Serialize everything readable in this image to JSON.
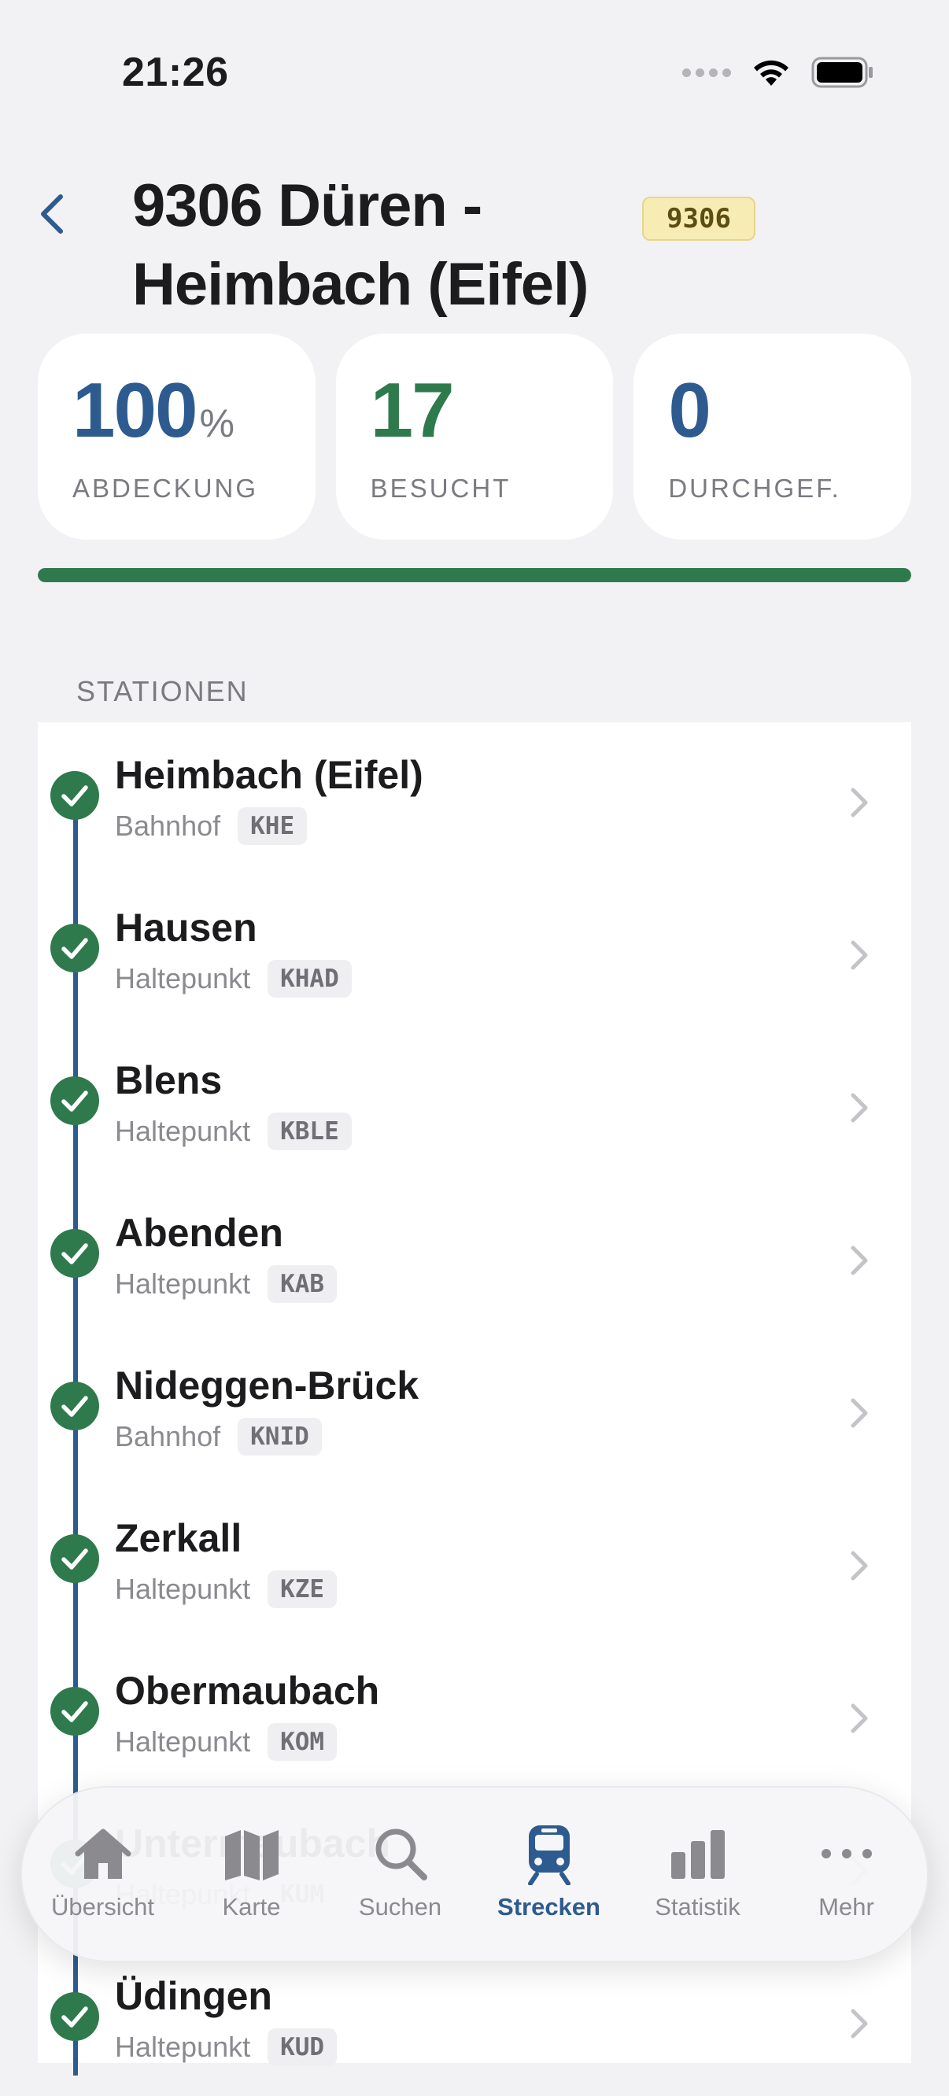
{
  "status_bar": {
    "time": "21:26"
  },
  "header": {
    "title": "9306 Düren - Heimbach (Eifel)",
    "badge": "9306"
  },
  "stats": [
    {
      "value": "100",
      "unit": "%",
      "label": "ABDECKUNG",
      "color": "#2e5b8f"
    },
    {
      "value": "17",
      "unit": "",
      "label": "BESUCHT",
      "color": "#2f7a4c"
    },
    {
      "value": "0",
      "unit": "",
      "label": "DURCHGEF.",
      "color": "#2e5b8f"
    }
  ],
  "coverage_progress": 1.0,
  "section_label": "STATIONEN",
  "stations": [
    {
      "name": "Heimbach (Eifel)",
      "type": "Bahnhof",
      "code": "KHE"
    },
    {
      "name": "Hausen",
      "type": "Haltepunkt",
      "code": "KHAD"
    },
    {
      "name": "Blens",
      "type": "Haltepunkt",
      "code": "KBLE"
    },
    {
      "name": "Abenden",
      "type": "Haltepunkt",
      "code": "KAB"
    },
    {
      "name": "Nideggen-Brück",
      "type": "Bahnhof",
      "code": "KNID"
    },
    {
      "name": "Zerkall",
      "type": "Haltepunkt",
      "code": "KZE"
    },
    {
      "name": "Obermaubach",
      "type": "Haltepunkt",
      "code": "KOM"
    },
    {
      "name": "Untermaubach",
      "type": "Haltepunkt",
      "code": "KUM"
    },
    {
      "name": "Üdingen",
      "type": "Haltepunkt",
      "code": "KUD"
    }
  ],
  "tabs": [
    {
      "label": "Übersicht",
      "icon": "house-icon",
      "active": false
    },
    {
      "label": "Karte",
      "icon": "map-icon",
      "active": false
    },
    {
      "label": "Suchen",
      "icon": "search-icon",
      "active": false
    },
    {
      "label": "Strecken",
      "icon": "train-icon",
      "active": true
    },
    {
      "label": "Statistik",
      "icon": "bar-chart-icon",
      "active": false
    },
    {
      "label": "Mehr",
      "icon": "ellipsis-icon",
      "active": false
    }
  ],
  "colors": {
    "accent": "#2e5b8f",
    "visited": "#2f7a4c",
    "badge_bg": "#f7ecb4"
  }
}
